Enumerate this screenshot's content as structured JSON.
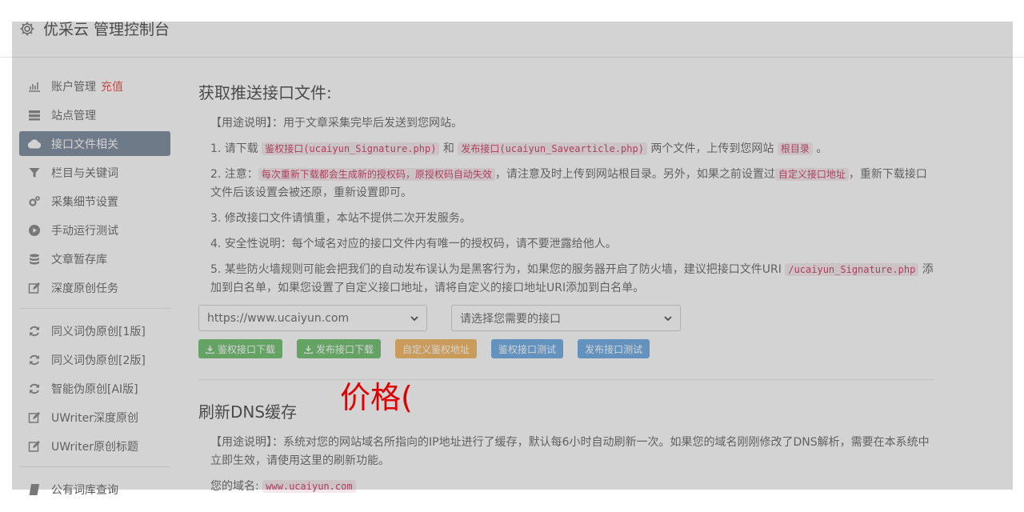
{
  "header": {
    "title": "优采云 管理控制台",
    "icon": "gear-icon"
  },
  "sidebar": {
    "items": [
      {
        "label": "账户管理",
        "badge": "充值",
        "icon": "bar-chart-icon"
      },
      {
        "label": "站点管理",
        "icon": "server-icon"
      },
      {
        "label": "接口文件相关",
        "icon": "cloud-upload-icon",
        "active": true
      },
      {
        "label": "栏目与关键词",
        "icon": "filter-icon"
      },
      {
        "label": "采集细节设置",
        "icon": "gears-icon"
      },
      {
        "label": "手动运行测试",
        "icon": "play-circle-icon"
      },
      {
        "label": "文章暂存库",
        "icon": "database-icon"
      },
      {
        "label": "深度原创任务",
        "icon": "edit-icon"
      }
    ],
    "items2": [
      {
        "label": "同义词伪原创[1版]",
        "icon": "refresh-icon"
      },
      {
        "label": "同义词伪原创[2版]",
        "icon": "refresh-icon"
      },
      {
        "label": "智能伪原创[AI版]",
        "icon": "refresh-icon"
      },
      {
        "label": "UWriter深度原创",
        "icon": "edit-icon"
      },
      {
        "label": "UWriter原创标题",
        "icon": "edit-icon"
      }
    ],
    "items3": [
      {
        "label": "公有词库查询",
        "icon": "book-icon"
      }
    ]
  },
  "push": {
    "title": "获取推送接口文件:",
    "usage": "【用途说明】：用于文章采集完毕后发送到您网站。",
    "s1_a": "1. 请下载 ",
    "s1_code1": "鉴权接口(ucaiyun_Signature.php)",
    "s1_b": " 和 ",
    "s1_code2": "发布接口(ucaiyun_Savearticle.php)",
    "s1_c": " 两个文件，上传到您网站 ",
    "s1_code3": "根目录",
    "s1_d": " 。",
    "s2_a": "2. 注意：",
    "s2_code1": "每次重新下载都会生成新的授权码，原授权码自动失效",
    "s2_b": "，请注意及时上传到网站根目录。另外，如果之前设置过",
    "s2_code2": "自定义接口地址",
    "s2_c": "，重新下载接口文件后该设置会被还原，重新设置即可。",
    "s3": "3. 修改接口文件请慎重，本站不提供二次开发服务。",
    "s4": "4. 安全性说明：每个域名对应的接口文件内有唯一的授权码，请不要泄露给他人。",
    "s5_a": "5. 某些防火墙规则可能会把我们的自动发布误认为是黑客行为，如果您的服务器开启了防火墙，建议把接口文件URI ",
    "s5_code": "/ucaiyun_Signature.php",
    "s5_b": " 添加到白名单，如果您设置了自定义接口地址，请将自定义的接口地址URI添加到白名单。",
    "site_select": "https://www.ucaiyun.com",
    "api_select": "请选择您需要的接口",
    "btn1": "鉴权接口下载",
    "btn2": "发布接口下载",
    "btn3": "自定义鉴权地址",
    "btn4": "鉴权接口测试",
    "btn5": "发布接口测试"
  },
  "dns": {
    "title": "刷新DNS缓存",
    "usage": "【用途说明】：系统对您的网站域名所指向的IP地址进行了缓存，默认每6小时自动刷新一次。如果您的域名刚刚修改了DNS解析，需要在本系统中立即生效，请使用这里的刷新功能。",
    "domain_label": "您的域名: ",
    "domain": "www.ucaiyun.com"
  },
  "annotation": "价格(",
  "colors": {
    "annotation": "#e00000",
    "active_nav": "#6b7b8f",
    "green": "#5cb85c",
    "orange": "#f0ad4e",
    "blue": "#5a9fe0"
  }
}
